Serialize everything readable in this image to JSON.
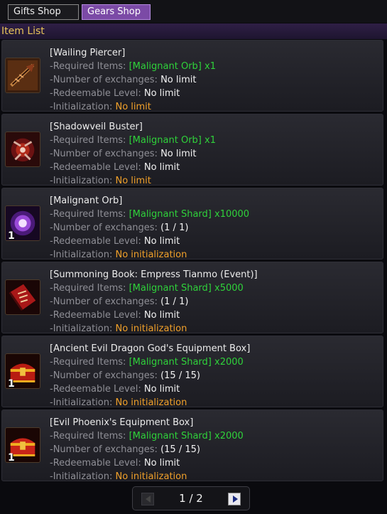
{
  "tabs": [
    {
      "label": "Gifts Shop",
      "active": false
    },
    {
      "label": "Gears Shop",
      "active": true
    }
  ],
  "list_header": "Item List",
  "labels": {
    "required": "-Required Items: ",
    "exchanges": "-Number of exchanges: ",
    "level": "-Redeemable Level: ",
    "init": "-Initialization: "
  },
  "items": [
    {
      "name": "[Wailing Piercer]",
      "required": "[Malignant Orb] x1",
      "exchanges": "No limit",
      "level": "No limit",
      "init": "No limit",
      "qty": "",
      "icon": "spear-icon"
    },
    {
      "name": "[Shadowveil Buster]",
      "required": "[Malignant Orb] x1",
      "exchanges": "No limit",
      "level": "No limit",
      "init": "No limit",
      "qty": "",
      "icon": "buster-weapon-icon"
    },
    {
      "name": "[Malignant Orb]",
      "required": "[Malignant Shard] x10000",
      "exchanges": "(1 / 1)",
      "level": "No limit",
      "init": "No initialization",
      "qty": "1",
      "icon": "orb-icon"
    },
    {
      "name": "[Summoning Book: Empress Tianmo (Event)]",
      "required": "[Malignant Shard] x5000",
      "exchanges": "(1 / 1)",
      "level": "No limit",
      "init": "No initialization",
      "qty": "",
      "icon": "book-icon"
    },
    {
      "name": "[Ancient Evil Dragon God's Equipment Box]",
      "required": "[Malignant Shard] x2000",
      "exchanges": "(15 / 15)",
      "level": "No limit",
      "init": "No initialization",
      "qty": "1",
      "icon": "treasure-chest-icon"
    },
    {
      "name": "[Evil Phoenix's Equipment Box]",
      "required": "[Malignant Shard] x2000",
      "exchanges": "(15 / 15)",
      "level": "No limit",
      "init": "No initialization",
      "qty": "1",
      "icon": "treasure-chest-icon"
    }
  ],
  "pager": {
    "current": "1",
    "separator": " / ",
    "total": "2",
    "text": "1 / 2"
  },
  "colors": {
    "accent_tab": "#7b4aa6",
    "header_text": "#e8c45a",
    "required_value": "#2fd23a",
    "init_value": "#f0a02a"
  }
}
